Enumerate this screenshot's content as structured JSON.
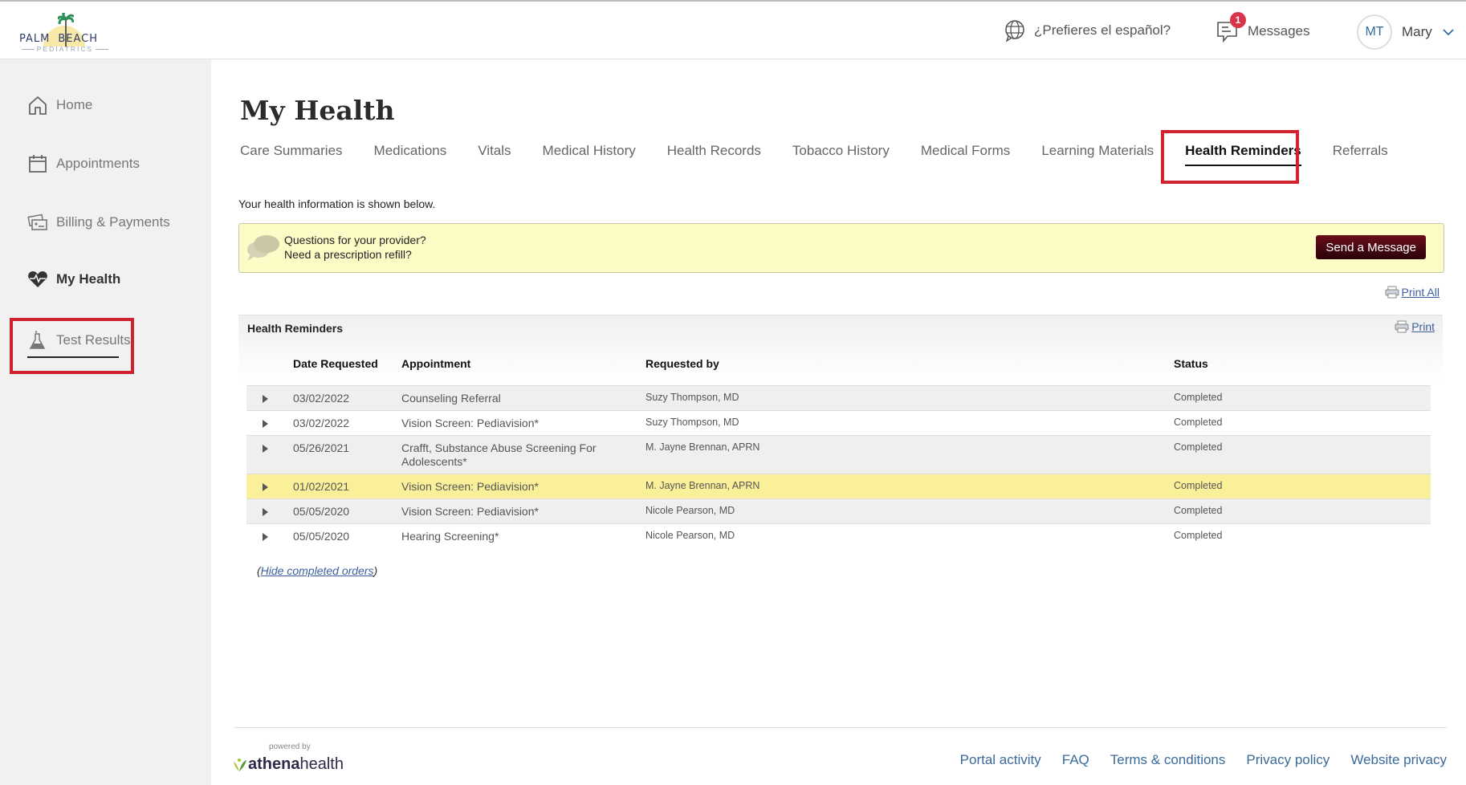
{
  "header": {
    "logo": {
      "line1a": "PALM",
      "line1b": "BEACH",
      "line2": "PEDIATRICS"
    },
    "language_link": "¿Prefieres el español?",
    "messages_label": "Messages",
    "messages_badge": "1",
    "user_initials": "MT",
    "user_name": "Mary"
  },
  "sidebar": {
    "items": [
      {
        "label": "Home",
        "icon": "home-icon"
      },
      {
        "label": "Appointments",
        "icon": "calendar-icon"
      },
      {
        "label": "Billing & Payments",
        "icon": "billing-icon"
      },
      {
        "label": "My Health",
        "icon": "heart-pulse-icon",
        "active": true
      },
      {
        "label": "Test Results",
        "icon": "flask-icon"
      }
    ]
  },
  "main": {
    "title": "My Health",
    "tabs": [
      {
        "label": "Care Summaries"
      },
      {
        "label": "Medications"
      },
      {
        "label": "Vitals"
      },
      {
        "label": "Medical History"
      },
      {
        "label": "Health Records"
      },
      {
        "label": "Tobacco History"
      },
      {
        "label": "Medical Forms"
      },
      {
        "label": "Learning Materials"
      },
      {
        "label": "Health Reminders",
        "active": true
      },
      {
        "label": "Referrals"
      }
    ],
    "intro": "Your health information is shown below.",
    "notice": {
      "line1": "Questions for your provider?",
      "line2": "Need a prescription refill?",
      "button": "Send a Message"
    },
    "print_all": "Print All",
    "panel": {
      "title": "Health Reminders",
      "print": "Print",
      "columns": [
        "Date Requested",
        "Appointment",
        "Requested by",
        "Status"
      ],
      "rows": [
        {
          "date": "03/02/2022",
          "appointment": "Counseling Referral",
          "requested_by": "Suzy Thompson, MD",
          "status": "Completed"
        },
        {
          "date": "03/02/2022",
          "appointment": "Vision Screen: Pediavision*",
          "requested_by": "Suzy Thompson, MD",
          "status": "Completed"
        },
        {
          "date": "05/26/2021",
          "appointment": "Crafft, Substance Abuse Screening For Adolescents*",
          "requested_by": "M. Jayne Brennan, APRN",
          "status": "Completed"
        },
        {
          "date": "01/02/2021",
          "appointment": "Vision Screen: Pediavision*",
          "requested_by": "M. Jayne Brennan, APRN",
          "status": "Completed",
          "highlighted": true
        },
        {
          "date": "05/05/2020",
          "appointment": "Vision Screen: Pediavision*",
          "requested_by": "Nicole Pearson, MD",
          "status": "Completed"
        },
        {
          "date": "05/05/2020",
          "appointment": "Hearing Screening*",
          "requested_by": "Nicole Pearson, MD",
          "status": "Completed"
        }
      ],
      "hide_completed": "Hide completed orders"
    }
  },
  "footer": {
    "powered_by": "powered by",
    "brand_bold": "athena",
    "brand_light": "health",
    "links": [
      "Portal activity",
      "FAQ",
      "Terms & conditions",
      "Privacy policy",
      "Website privacy"
    ]
  },
  "colors": {
    "highlight_box": "#d0222e",
    "row_highlight": "#fbf09a",
    "notice_bg": "#fdfbc6",
    "send_button": "#4a0812",
    "link": "#3b6a9a"
  }
}
